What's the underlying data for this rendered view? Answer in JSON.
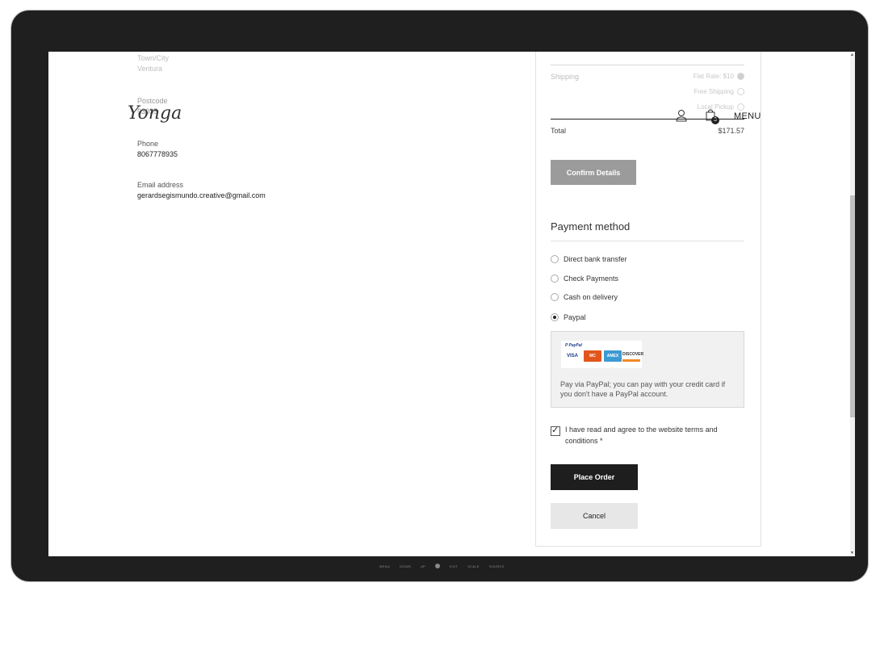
{
  "header": {
    "logo": "Yonga",
    "menu_label": "MENU",
    "cart_count": "3"
  },
  "billing": {
    "fields": [
      {
        "label": "Town/City",
        "value": "Ventura"
      },
      {
        "label": "Postcode",
        "value": "93035"
      },
      {
        "label": "Phone",
        "value": "8067778935"
      },
      {
        "label": "Email address",
        "value": "gerardsegismundo.creative@gmail.com"
      }
    ]
  },
  "order": {
    "shipping_label": "Shipping",
    "shipping_options": [
      {
        "label": "Flat Rate: $10",
        "selected": true
      },
      {
        "label": "Free Shipping",
        "selected": false
      },
      {
        "label": "Local Pickup",
        "selected": false
      }
    ],
    "total_label": "Total",
    "total_value": "$171.57",
    "confirm_label": "Confirm Details"
  },
  "payment": {
    "title": "Payment method",
    "options": [
      {
        "label": "Direct bank transfer",
        "selected": false
      },
      {
        "label": "Check Payments",
        "selected": false
      },
      {
        "label": "Cash on delivery",
        "selected": false
      },
      {
        "label": "Paypal",
        "selected": true
      }
    ],
    "paypal_wordmark": "P PayPal",
    "cards": [
      "VISA",
      "MC",
      "AMEX",
      "DISCOVER"
    ],
    "paypal_description": "Pay via PayPal; you can pay with your credit card if you don't have a PayPal account.",
    "terms_text": "I have read and agree to the website terms and conditions *",
    "terms_checked": true,
    "place_order_label": "Place Order",
    "cancel_label": "Cancel"
  },
  "monitor": {
    "osd_labels": [
      "MENU",
      "DOWN",
      "UP",
      "EXIT",
      "SCALE",
      "SOURCE"
    ]
  }
}
